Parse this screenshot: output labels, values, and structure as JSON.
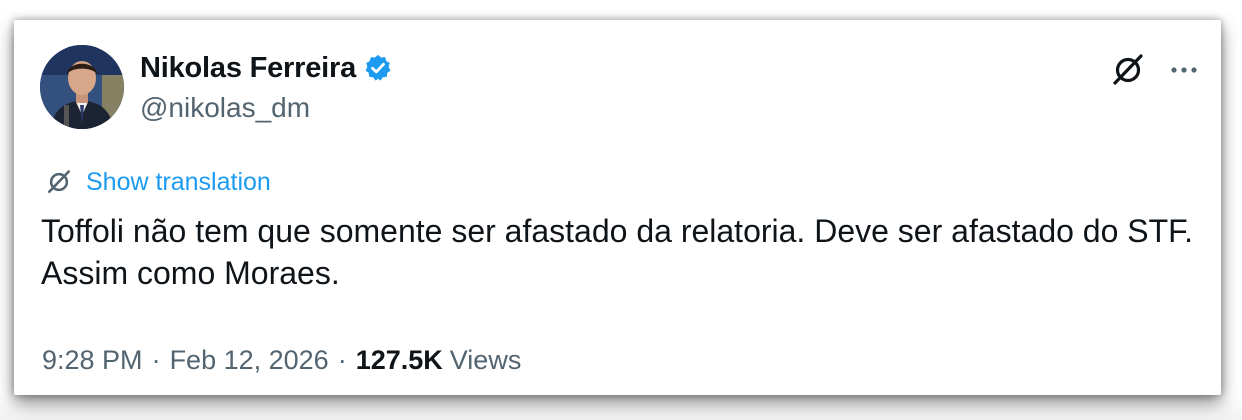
{
  "author": {
    "display_name": "Nikolas Ferreira",
    "handle": "@nikolas_dm",
    "verified": true,
    "verified_color": "#1d9bf0"
  },
  "actions": {
    "grok_icon": "grok-icon",
    "more_icon": "more-icon"
  },
  "translation": {
    "label": "Show translation",
    "icon": "grok-icon",
    "color": "#1d9bf0"
  },
  "tweet": {
    "text": "Toffoli não tem que somente ser afastado da relatoria. Deve ser afastado do STF. Assim como Moraes."
  },
  "meta": {
    "time": "9:28 PM",
    "separator": "·",
    "date": "Feb 12, 2026",
    "views_count": "127.5K",
    "views_label": "Views"
  }
}
